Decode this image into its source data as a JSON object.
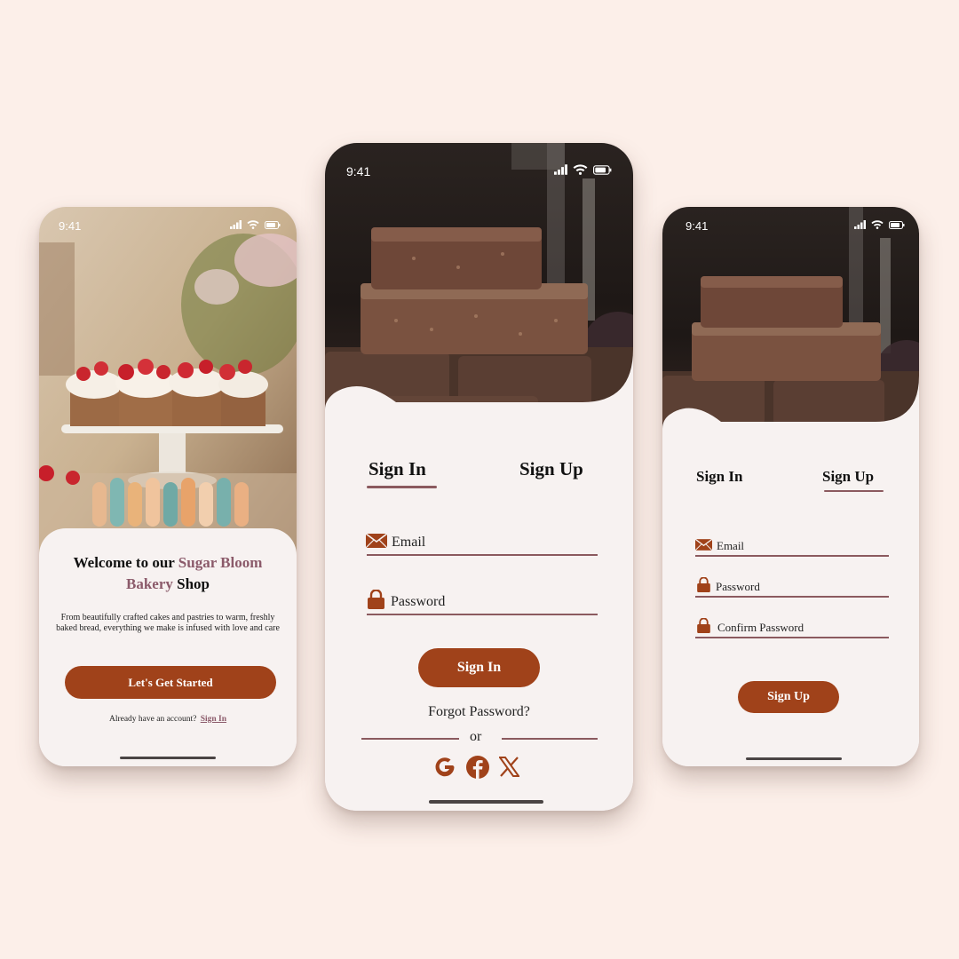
{
  "colors": {
    "background": "#fcefe9",
    "brand": "#a0421a",
    "accent": "#8b5a6a",
    "line": "#8b5a5f",
    "panel": "#f7f2f1"
  },
  "status_bar": {
    "time": "9:41",
    "icons": [
      "signal-icon",
      "wifi-icon",
      "battery-icon"
    ]
  },
  "welcome": {
    "title_pre": "Welcome to our ",
    "title_brand": "Sugar Bloom Bakery",
    "title_post": " Shop",
    "description": "From beautifully crafted cakes and pastries to warm, freshly baked bread, everything we make is infused with love and care",
    "cta_label": "Let's Get Started",
    "account_prompt": "Already have an account?",
    "sign_in_link": "Sign In"
  },
  "signin": {
    "tab_signin": "Sign In",
    "tab_signup": "Sign Up",
    "active_tab": "Sign In",
    "email_label": "Email",
    "password_label": "Password",
    "submit_label": "Sign In",
    "forgot_label": "Forgot Password?",
    "divider_label": "or",
    "social_icons": [
      "google-icon",
      "facebook-icon",
      "x-icon"
    ]
  },
  "signup": {
    "tab_signin": "Sign In",
    "tab_signup": "Sign Up",
    "active_tab": "Sign Up",
    "email_label": "Email",
    "password_label": "Password",
    "confirm_label": "Confirm Password",
    "submit_label": "Sign Up"
  }
}
